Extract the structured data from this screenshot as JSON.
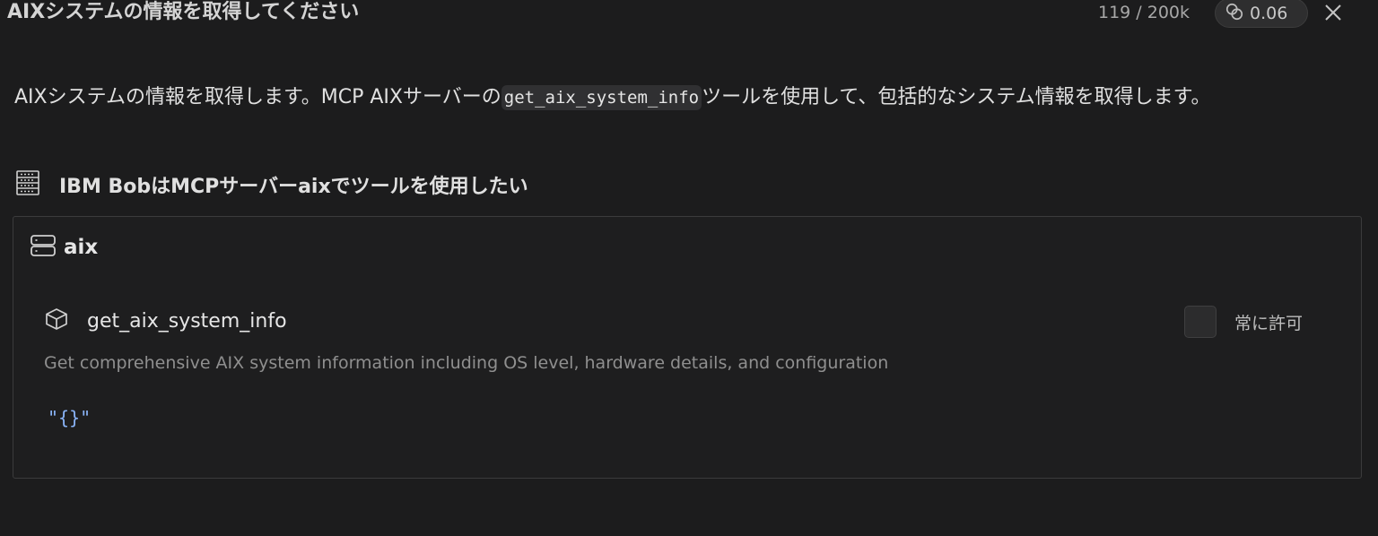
{
  "header": {
    "title": "AIXシステムの情報を取得してください",
    "token_count": "119 / 200k",
    "cost": "0.06",
    "cost_icon": "coins-icon",
    "close_icon": "close-icon"
  },
  "message": {
    "text_before": "AIXシステムの情報を取得します。MCP AIXサーバーの",
    "code": "get_aix_system_info",
    "text_after": "ツールを使用して、包括的なシステム情報を取得します。"
  },
  "permission": {
    "icon": "server-rack-icon",
    "text": "IBM BobはMCPサーバーaixでツールを使用したい"
  },
  "server": {
    "icon": "server-icon",
    "name": "aix",
    "tool": {
      "icon": "cube-icon",
      "name": "get_aix_system_info",
      "description": "Get comprehensive AIX system information including OS level, hardware details, and configuration",
      "arguments": "\"{}\"",
      "always_allow_label": "常に許可",
      "always_allow_checked": false
    }
  },
  "colors": {
    "background": "#1c1c1d",
    "panel": "#1e1e1f",
    "argument": "#8ab4f8"
  }
}
